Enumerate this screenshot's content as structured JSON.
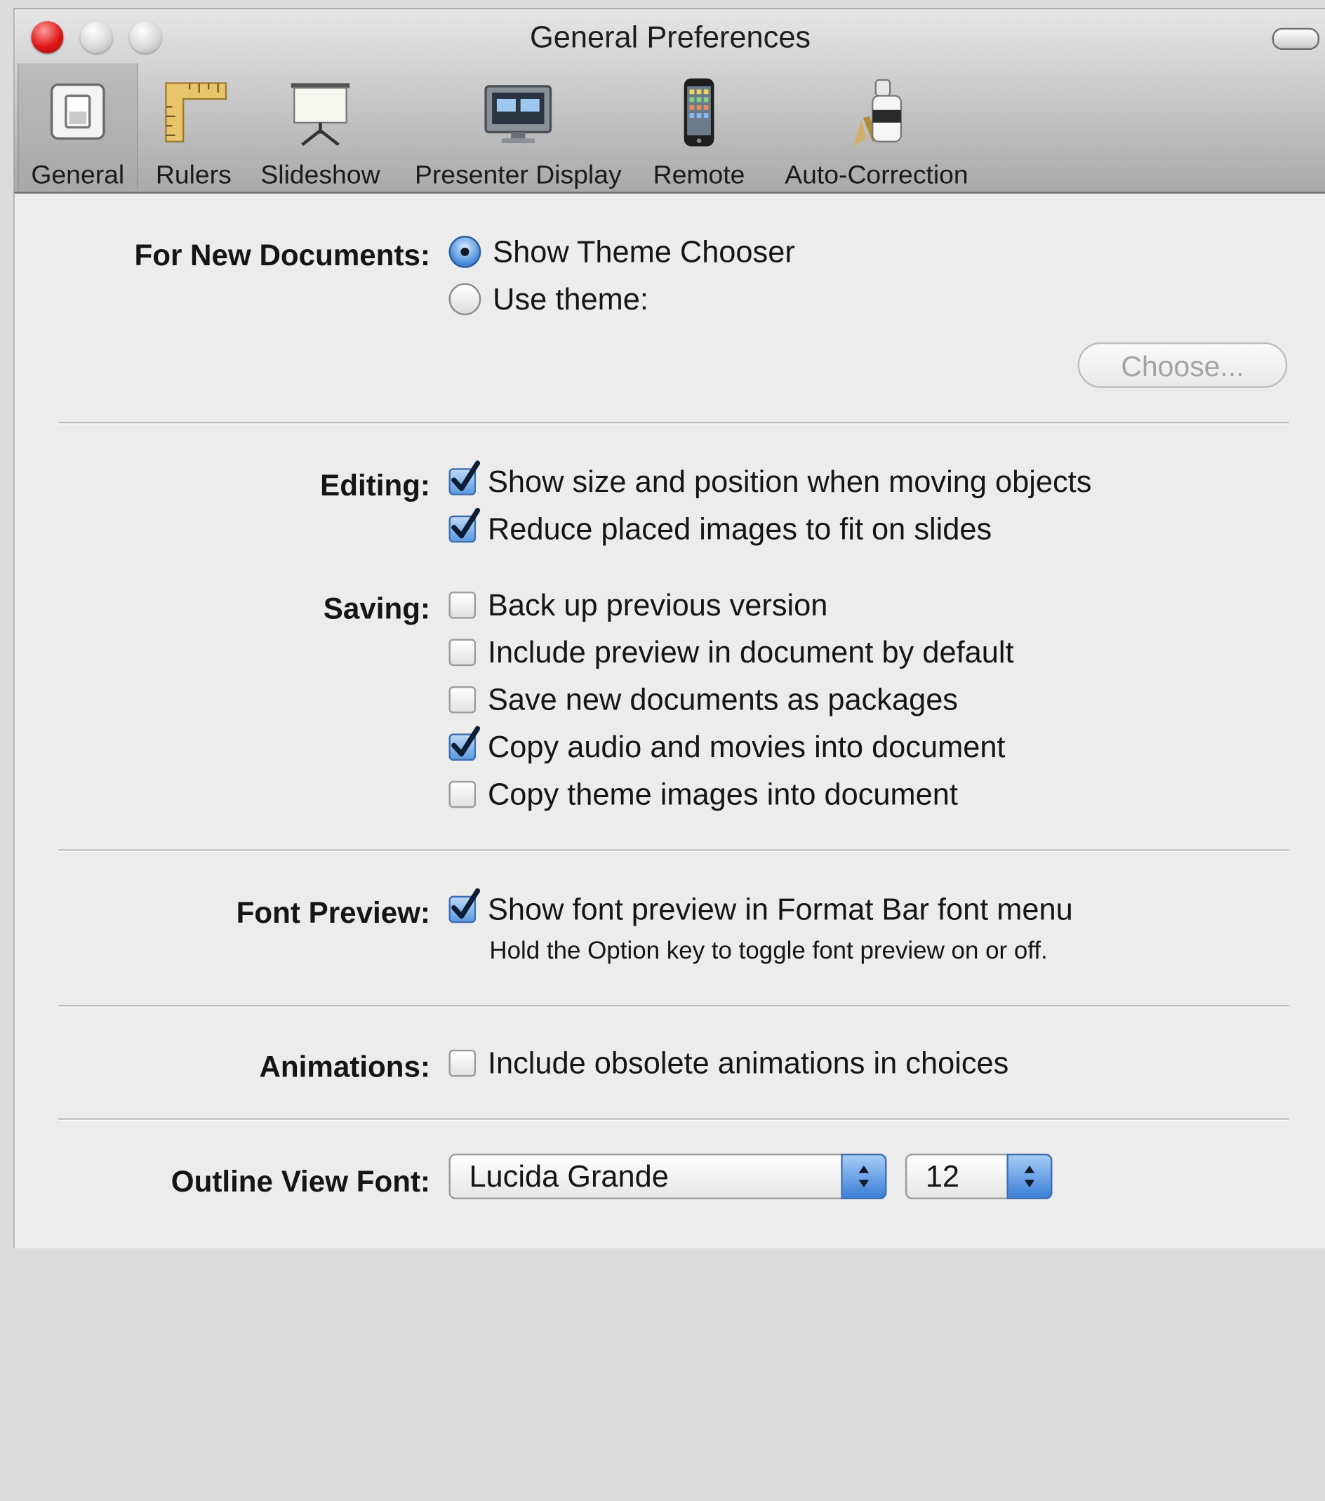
{
  "window": {
    "title": "General Preferences"
  },
  "toolbar": {
    "items": [
      {
        "label": "General",
        "icon": "light-switch-icon",
        "selected": true
      },
      {
        "label": "Rulers",
        "icon": "ruler-icon",
        "selected": false
      },
      {
        "label": "Slideshow",
        "icon": "projection-screen-icon",
        "selected": false
      },
      {
        "label": "Presenter Display",
        "icon": "display-monitor-icon",
        "selected": false
      },
      {
        "label": "Remote",
        "icon": "iphone-remote-icon",
        "selected": false
      },
      {
        "label": "Auto-Correction",
        "icon": "correction-bottle-icon",
        "selected": false
      }
    ]
  },
  "new_documents": {
    "label": "For New Documents:",
    "options": [
      {
        "label": "Show Theme Chooser",
        "selected": true
      },
      {
        "label": "Use theme:",
        "selected": false
      }
    ],
    "choose_button": "Choose..."
  },
  "editing": {
    "label": "Editing:",
    "options": [
      {
        "label": "Show size and position when moving objects",
        "checked": true
      },
      {
        "label": "Reduce placed images to fit on slides",
        "checked": true
      }
    ]
  },
  "saving": {
    "label": "Saving:",
    "options": [
      {
        "label": "Back up previous version",
        "checked": false
      },
      {
        "label": "Include preview in document by default",
        "checked": false
      },
      {
        "label": "Save new documents as packages",
        "checked": false
      },
      {
        "label": "Copy audio and movies into document",
        "checked": true
      },
      {
        "label": "Copy theme images into document",
        "checked": false
      }
    ]
  },
  "font_preview": {
    "label": "Font Preview:",
    "option": {
      "label": "Show font preview in Format Bar font menu",
      "checked": true
    },
    "note": "Hold the Option key to toggle font preview on or off."
  },
  "animations": {
    "label": "Animations:",
    "option": {
      "label": "Include obsolete animations in choices",
      "checked": false
    }
  },
  "outline_font": {
    "label": "Outline View Font:",
    "font_value": "Lucida Grande",
    "size_value": "12"
  },
  "colors": {
    "accent": "#3a7fd8",
    "close_button": "#e01818",
    "window_bg": "#ececec"
  }
}
